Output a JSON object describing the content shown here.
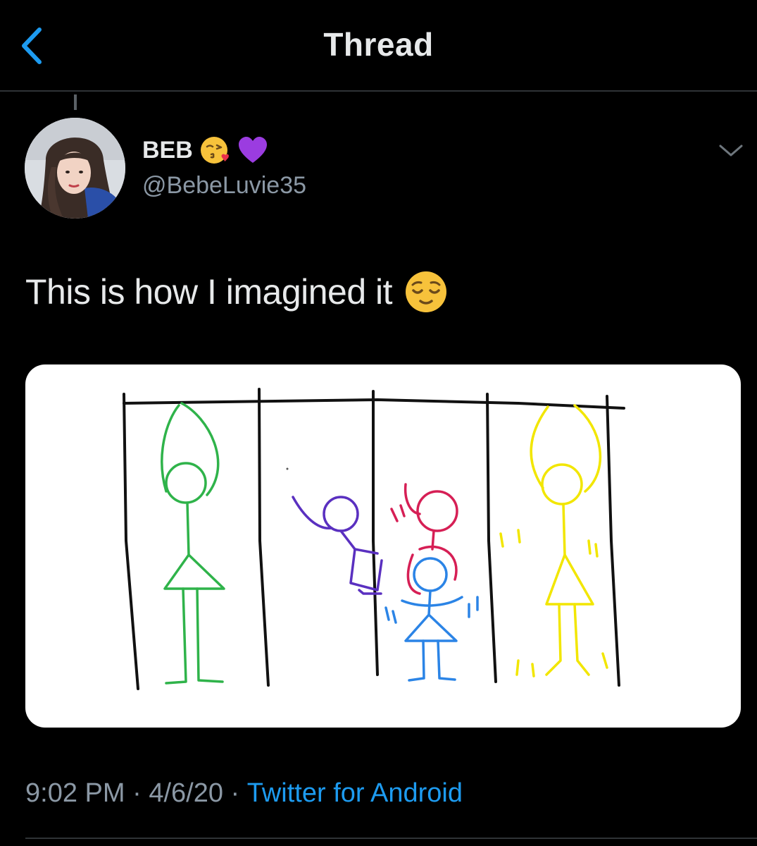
{
  "header": {
    "title": "Thread",
    "back_icon": "chevron-left-icon",
    "accent_color": "#1d9bf0"
  },
  "tweet": {
    "display_name": "BEB",
    "name_emojis": [
      "face-blowing-kiss-emoji",
      "purple-heart-emoji"
    ],
    "handle": "@BebeLuvie35",
    "text": "This is how I imagined it",
    "text_emoji": "relieved-face-emoji",
    "more_icon": "chevron-down-icon",
    "timestamp": "9:02 PM",
    "date": "4/6/20",
    "separator": " · ",
    "source": "Twitter for Android"
  }
}
